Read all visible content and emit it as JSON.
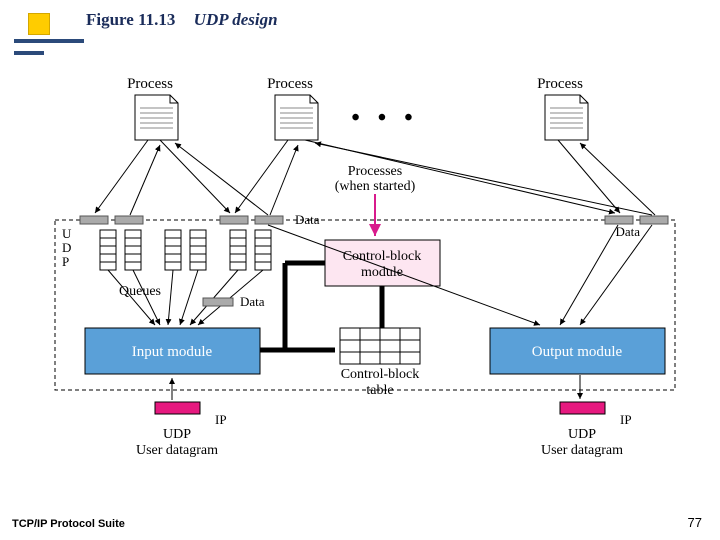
{
  "title": {
    "figure": "Figure 11.13",
    "subject": "UDP design"
  },
  "footer": {
    "left": "TCP/IP Protocol Suite",
    "page": "77"
  },
  "labels": {
    "process1": "Process",
    "process2": "Process",
    "process3": "Process",
    "ellipsis": "• • •",
    "data1": "Data",
    "data2": "Data",
    "data3": "Data",
    "processes_when_started": "Processes",
    "processes_when_started2": "(when started)",
    "udp_side": "U\nD\nP",
    "queues": "Queues",
    "data_center": "Data",
    "control_block_module": "Control-block",
    "control_block_module2": "module",
    "input_module": "Input module",
    "output_module": "Output module",
    "control_block_table": "Control-block",
    "control_block_table2": "table",
    "ip1": "IP",
    "ip2": "IP",
    "udp_datagram": "UDP",
    "user_datagram": "User datagram",
    "udp_datagram2": "UDP",
    "user_datagram2": "User datagram"
  }
}
